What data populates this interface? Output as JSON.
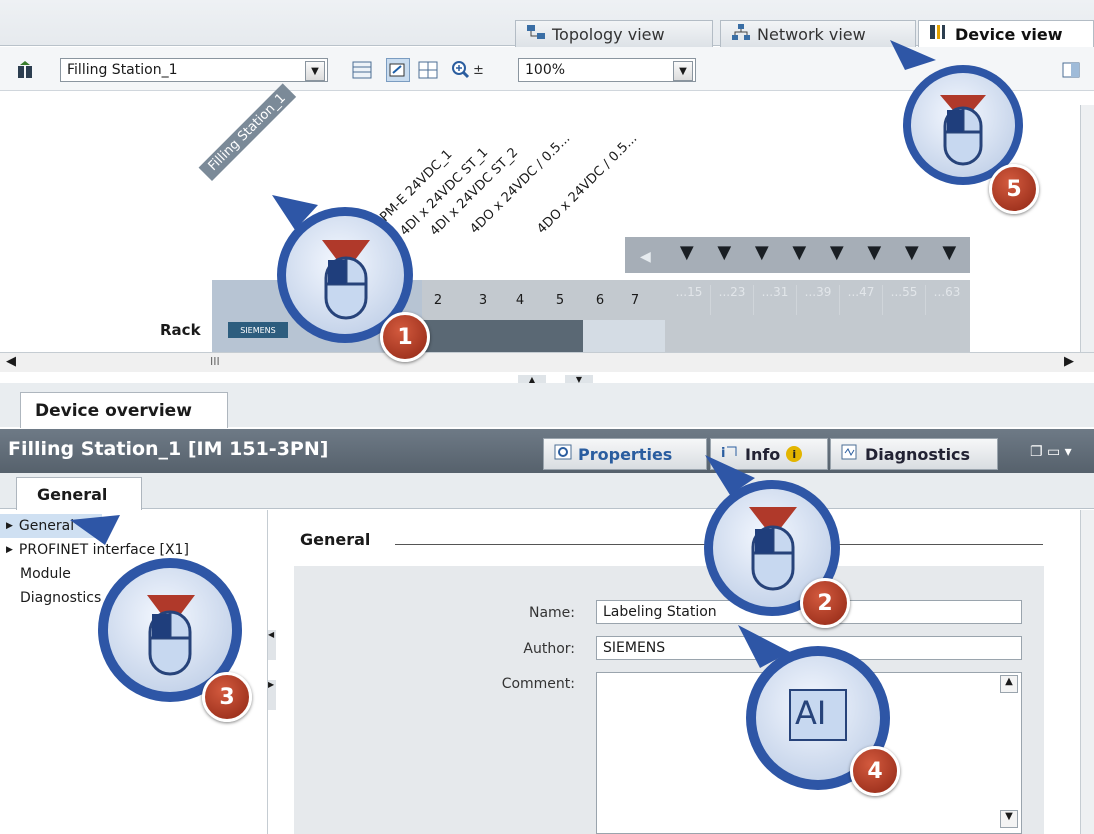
{
  "views": {
    "tabs": [
      {
        "label": "Topology view",
        "icon": "topology-icon"
      },
      {
        "label": "Network view",
        "icon": "network-icon"
      },
      {
        "label": "Device view",
        "icon": "device-icon"
      }
    ]
  },
  "toolbar": {
    "device_select": "Filling Station_1",
    "zoom_value": "100%"
  },
  "canvas": {
    "station_label": "Filling Station_1",
    "module_labels": [
      "PM-E 24VDC_1",
      "4DI x 24VDC ST_1",
      "4DI x 24VDC ST_2",
      "4DO x 24VDC / 0.5...",
      "4DO x 24VDC / 0.5..."
    ],
    "rack_label": "Rack",
    "siemens_label": "SIEMENS",
    "slot_numbers": [
      "2",
      "3",
      "4",
      "5",
      "6",
      "7"
    ],
    "slot_ranges": [
      "...15",
      "...23",
      "...31",
      "...39",
      "...47",
      "...55",
      "...63"
    ],
    "scroll_marker": "III"
  },
  "panel": {
    "device_overview_tab": "Device overview",
    "title": "Filling Station_1 [IM 151-3PN]",
    "tabs": {
      "properties": "Properties",
      "info": "Info",
      "diagnostics": "Diagnostics"
    },
    "general_tab": "General",
    "tree": [
      "General",
      "PROFINET interface [X1]",
      "Module",
      "Diagnostics"
    ],
    "section_title": "General",
    "fields": {
      "name_label": "Name:",
      "name_value": "Labeling Station",
      "author_label": "Author:",
      "author_value": "SIEMENS",
      "comment_label": "Comment:"
    }
  },
  "callouts": {
    "c1": "1",
    "c2": "2",
    "c3": "3",
    "c4": "4",
    "c5": "5",
    "text_cursor": "AI"
  }
}
